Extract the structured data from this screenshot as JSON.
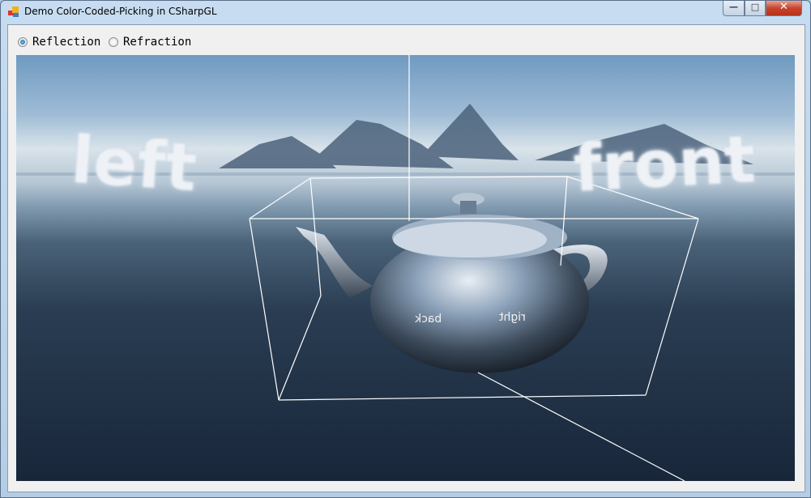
{
  "window": {
    "title": "Demo Color-Coded-Picking in CSharpGL",
    "minimize_label": "—",
    "maximize_label": "□",
    "close_label": "✕",
    "icon": "app-window-icon"
  },
  "options": {
    "items": [
      {
        "label": "Reflection",
        "checked": true
      },
      {
        "label": "Refraction",
        "checked": false
      }
    ]
  },
  "scene": {
    "skybox_labels": {
      "left": "left",
      "front": "front"
    },
    "teapot_reflections": {
      "back": "back",
      "right": "right"
    }
  }
}
